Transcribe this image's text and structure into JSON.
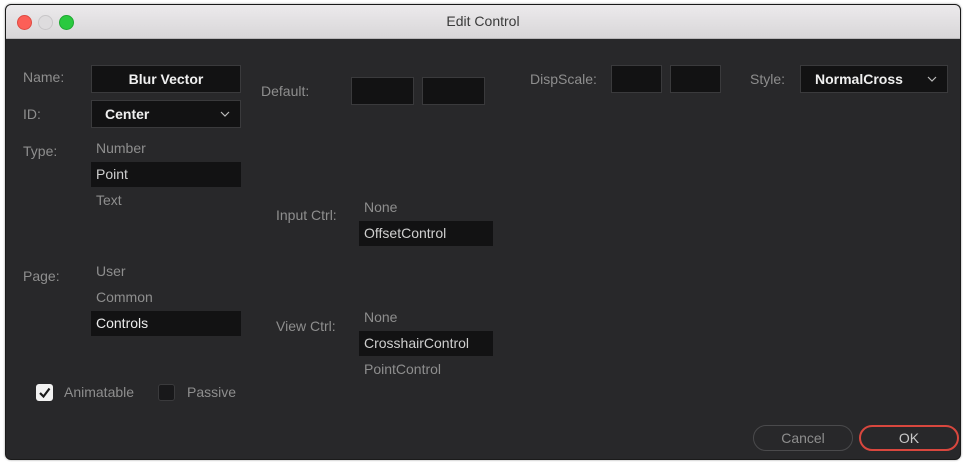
{
  "window": {
    "title": "Edit Control"
  },
  "name": {
    "label": "Name:",
    "value": "Blur Vector"
  },
  "id": {
    "label": "ID:",
    "value": "Center"
  },
  "type": {
    "label": "Type:",
    "options": [
      "Number",
      "Point",
      "Text"
    ],
    "selected": "Point"
  },
  "page": {
    "label": "Page:",
    "options": [
      "User",
      "Common",
      "Controls"
    ],
    "selected": "Controls"
  },
  "animatable": {
    "label": "Animatable",
    "checked": true
  },
  "passive": {
    "label": "Passive",
    "checked": false
  },
  "default": {
    "label": "Default:",
    "values": [
      "",
      ""
    ]
  },
  "input_ctrl": {
    "label": "Input Ctrl:",
    "options": [
      "None",
      "OffsetControl"
    ],
    "selected": "OffsetControl"
  },
  "view_ctrl": {
    "label": "View Ctrl:",
    "options": [
      "None",
      "CrosshairControl",
      "PointControl"
    ],
    "selected": "CrosshairControl"
  },
  "disp_scale": {
    "label": "DispScale:",
    "values": [
      "",
      ""
    ]
  },
  "style": {
    "label": "Style:",
    "value": "NormalCross"
  },
  "buttons": {
    "cancel": "Cancel",
    "ok": "OK"
  },
  "colors": {
    "window_bg": "#28282a",
    "field_bg": "#121213",
    "accent_ok": "#d9473e"
  },
  "icons": [
    "close-traffic-light",
    "minimize-traffic-light",
    "maximize-traffic-light",
    "chevron-down-icon",
    "checkmark-icon"
  ]
}
